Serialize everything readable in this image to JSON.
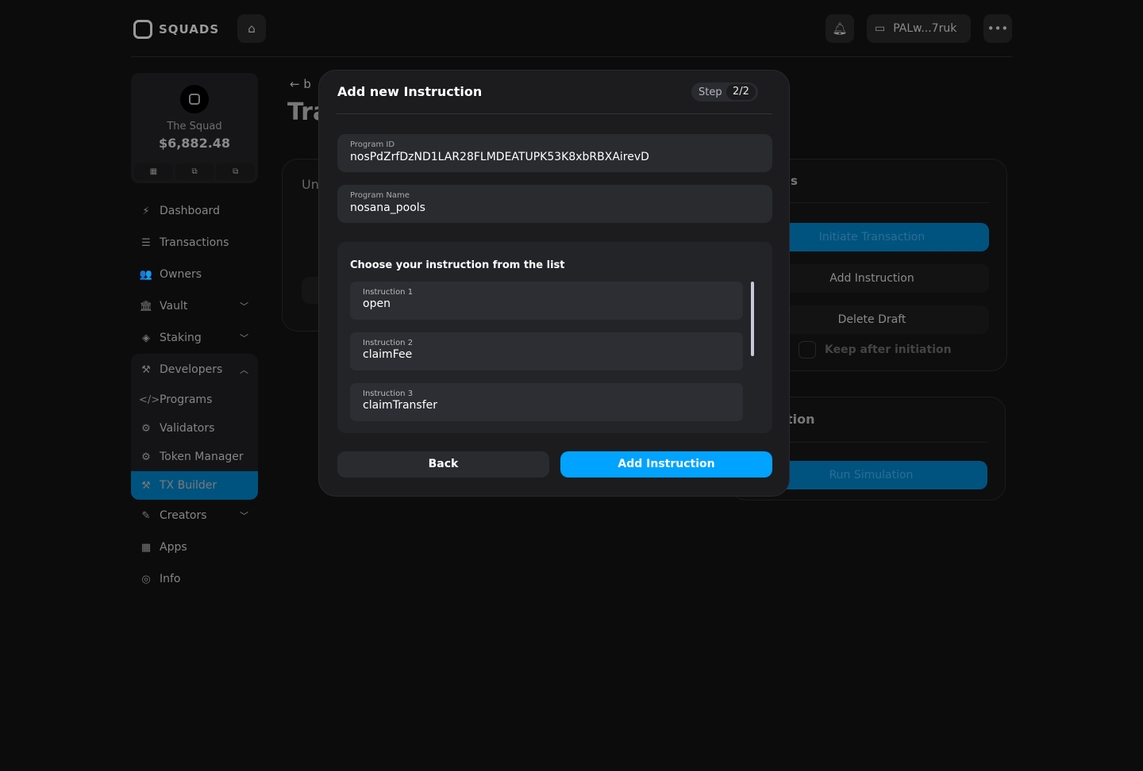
{
  "header": {
    "logo": "SQUADS",
    "wallet": "PALw...7ruk",
    "icons": [
      "home-icon",
      "bell-icon",
      "wallet-icon",
      "more-icon"
    ]
  },
  "squad": {
    "name": "The Squad",
    "balance": "$6,882.48"
  },
  "sidebar": {
    "items": [
      {
        "label": "Dashboard",
        "icon": "⚡"
      },
      {
        "label": "Transactions",
        "icon": "☰"
      },
      {
        "label": "Owners",
        "icon": "👥"
      },
      {
        "label": "Vault",
        "icon": "🏛"
      },
      {
        "label": "Staking",
        "icon": "◈"
      }
    ],
    "developers": {
      "label": "Developers",
      "icon": "⚒",
      "children": [
        {
          "label": "Programs",
          "icon": "</>"
        },
        {
          "label": "Validators",
          "icon": "⚙"
        },
        {
          "label": "Token Manager",
          "icon": "⚙"
        },
        {
          "label": "TX Builder",
          "icon": "⚒"
        }
      ]
    },
    "bottom": [
      {
        "label": "Creators",
        "icon": "✎"
      },
      {
        "label": "Apps",
        "icon": "▦"
      },
      {
        "label": "Info",
        "icon": "◎"
      }
    ]
  },
  "background": {
    "back": "b",
    "title": "Tra",
    "left_card": "Un",
    "right_card_title": "s",
    "initiate": "Initiate Transaction",
    "add_instruction": "Add Instruction",
    "delete_draft": "Delete Draft",
    "keep": "Keep after initiation",
    "sim_title": "tion",
    "run_sim": "Run Simulation"
  },
  "modal": {
    "title": "Add new Instruction",
    "step_label": "Step",
    "step_value": "2/2",
    "program_id_label": "Program ID",
    "program_id": "nosPdZrfDzND1LAR28FLMDEATUPK53K8xbRBXAirevD",
    "program_name_label": "Program Name",
    "program_name": "nosana_pools",
    "list_title": "Choose your instruction from the list",
    "instructions": [
      {
        "label": "Instruction 1",
        "name": "open"
      },
      {
        "label": "Instruction 2",
        "name": "claimFee"
      },
      {
        "label": "Instruction 3",
        "name": "claimTransfer"
      }
    ],
    "back": "Back",
    "add": "Add Instruction"
  },
  "colors": {
    "accent": "#00a3ff",
    "active_nav": "#00537f"
  }
}
